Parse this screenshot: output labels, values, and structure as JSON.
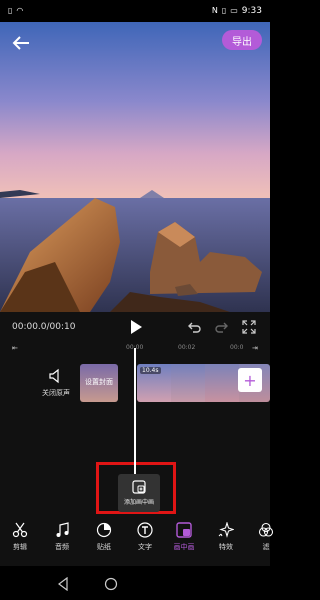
{
  "status_bar": {
    "time": "9:33",
    "icons": [
      "sim-icon",
      "wifi-icon",
      "nfc-icon",
      "vibrate-icon",
      "battery-icon"
    ]
  },
  "header": {
    "back_icon": "back-arrow-icon",
    "export_label": "导出"
  },
  "playback": {
    "timecode": "00:00.0/00:10",
    "play_icon": "play-icon",
    "undo_icon": "undo-icon",
    "redo_icon": "redo-icon",
    "fullscreen_icon": "fullscreen-icon"
  },
  "ruler": {
    "ticks": [
      "00:00",
      "00:02",
      "00:0"
    ]
  },
  "tracks": {
    "mute_label": "关闭原声",
    "cover_label": "设置封面",
    "clip_duration": "10.4s"
  },
  "pip": {
    "label": "添加画中画"
  },
  "toolbar": {
    "items": [
      {
        "label": "剪辑",
        "icon": "scissors-icon"
      },
      {
        "label": "音频",
        "icon": "music-note-icon"
      },
      {
        "label": "贴纸",
        "icon": "sticker-icon"
      },
      {
        "label": "文字",
        "icon": "text-icon"
      },
      {
        "label": "画中画",
        "icon": "pip-icon"
      },
      {
        "label": "特效",
        "icon": "sparkle-icon"
      },
      {
        "label": "滤",
        "icon": "filter-icon"
      }
    ]
  },
  "colors": {
    "accent": "#b35bd8",
    "highlight": "#e01515",
    "background": "#111111"
  }
}
